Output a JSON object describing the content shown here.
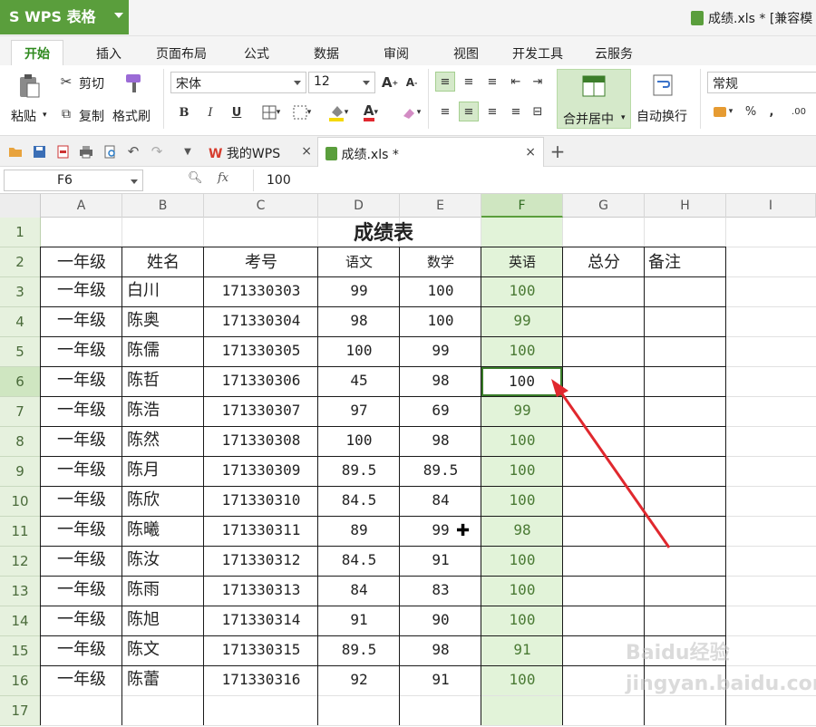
{
  "app": {
    "name": "WPS 表格",
    "window_title": "成绩.xls * [兼容模"
  },
  "ribbon_tabs": [
    "开始",
    "插入",
    "页面布局",
    "公式",
    "数据",
    "审阅",
    "视图",
    "开发工具",
    "云服务"
  ],
  "ribbon": {
    "paste": "粘贴",
    "cut": "剪切",
    "copy": "复制",
    "format_painter": "格式刷",
    "font_name": "宋体",
    "font_size": "12",
    "merge_center": "合并居中",
    "wrap_text": "自动换行",
    "number_format": "常规",
    "bold": "B",
    "italic": "I",
    "underline": "U",
    "percent": "%",
    "comma": ","
  },
  "doc_tabs": [
    {
      "label": "我的WPS",
      "active": false
    },
    {
      "label": "成绩.xls *",
      "active": true
    }
  ],
  "formula_bar": {
    "cell_ref": "F6",
    "fx": "fx",
    "value": "100"
  },
  "columns": [
    "A",
    "B",
    "C",
    "D",
    "E",
    "F",
    "G",
    "H",
    "I"
  ],
  "rows": [
    "1",
    "2",
    "3",
    "4",
    "5",
    "6",
    "7",
    "8",
    "9",
    "10",
    "11",
    "12",
    "13",
    "14",
    "15",
    "16",
    "17"
  ],
  "sheet": {
    "title": "成绩表",
    "headers": [
      "一年级",
      "姓名",
      "考号",
      "语文",
      "数学",
      "英语",
      "总分",
      "备注"
    ],
    "records": [
      [
        "一年级",
        "白川",
        "171330303",
        "99",
        "100",
        "100"
      ],
      [
        "一年级",
        "陈奥",
        "171330304",
        "98",
        "100",
        "99"
      ],
      [
        "一年级",
        "陈儒",
        "171330305",
        "100",
        "99",
        "100"
      ],
      [
        "一年级",
        "陈哲",
        "171330306",
        "45",
        "98",
        "100"
      ],
      [
        "一年级",
        "陈浩",
        "171330307",
        "97",
        "69",
        "99"
      ],
      [
        "一年级",
        "陈然",
        "171330308",
        "100",
        "98",
        "100"
      ],
      [
        "一年级",
        "陈月",
        "171330309",
        "89.5",
        "89.5",
        "100"
      ],
      [
        "一年级",
        "陈欣",
        "171330310",
        "84.5",
        "84",
        "100"
      ],
      [
        "一年级",
        "陈曦",
        "171330311",
        "89",
        "99",
        "98"
      ],
      [
        "一年级",
        "陈汝",
        "171330312",
        "84.5",
        "91",
        "100"
      ],
      [
        "一年级",
        "陈雨",
        "171330313",
        "84",
        "83",
        "100"
      ],
      [
        "一年级",
        "陈旭",
        "171330314",
        "91",
        "90",
        "100"
      ],
      [
        "一年级",
        "陈文",
        "171330315",
        "89.5",
        "98",
        "91"
      ],
      [
        "一年级",
        "陈蕾",
        "171330316",
        "92",
        "91",
        "100"
      ]
    ]
  },
  "selected_cell": "F6",
  "colors": {
    "accent": "#5a9e3c",
    "selection_fill": "#e2f3d9",
    "arrow": "#e0282e"
  },
  "watermark": "Baidu经验 jingyan.baidu.com"
}
